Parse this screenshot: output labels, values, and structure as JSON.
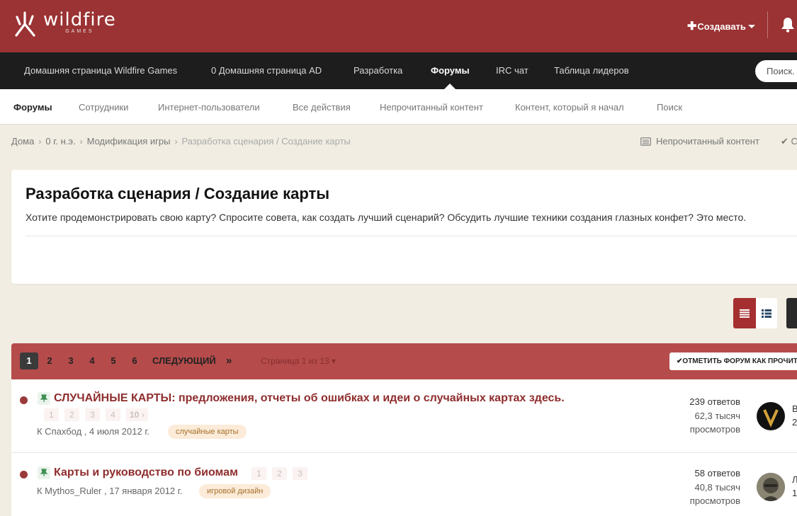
{
  "header": {
    "logo_word": "wildfire",
    "logo_sub": "GAMES",
    "create_label": "Создавать",
    "icons": [
      "wildfire-logo-icon",
      "plus-icon",
      "caret-down-icon",
      "bell-icon"
    ]
  },
  "nav": {
    "items": [
      {
        "label": "Домашняя страница Wildfire Games"
      },
      {
        "label": "0 Домашняя страница AD"
      },
      {
        "label": "Разработка"
      },
      {
        "label": "Форумы"
      },
      {
        "label": "IRC чат"
      },
      {
        "label": "Таблица лидеров"
      }
    ],
    "active_label": "Форумы",
    "search_placeholder": "Поиск."
  },
  "subnav": {
    "items": [
      {
        "label": "Форумы"
      },
      {
        "label": "Сотрудники"
      },
      {
        "label": "Интернет-пользователи"
      },
      {
        "label": "Все действия"
      },
      {
        "label": "Непрочитанный контент"
      },
      {
        "label": "Контент, который я начал"
      },
      {
        "label": "Поиск"
      }
    ],
    "active_label": "Форумы"
  },
  "breadcrumb": {
    "items": [
      "Дома",
      "0 г. н.э.",
      "Модификация игры",
      "Разработка сценария / Создание карты"
    ],
    "right_link": "Непрочитанный контент",
    "right_link2": "С"
  },
  "forum": {
    "title": "Разработка сценария / Создание карты",
    "description": "Хотите продемонстрировать свою карту? Спросите совета, как создать лучший сценарий? Обсудить лучшие техники создания глазных конфет? Это место."
  },
  "pagination": {
    "pages": [
      "1",
      "2",
      "3",
      "4",
      "5",
      "6"
    ],
    "current": "1",
    "next_label": "СЛЕДУЮЩИЙ",
    "last_label": "»",
    "page_info": "Страница 1 из 13",
    "mark_read_label": "ОТМЕТИТЬ ФОРУМ КАК ПРОЧИТАННЫЙ"
  },
  "topics": [
    {
      "title": "СЛУЧАЙНЫЕ КАРТЫ: предложения, отчеты об ошибках и идеи о случайных картах здесь.",
      "pages": [
        "1",
        "2",
        "3",
        "4",
        "10"
      ],
      "author_line": "К Спахбод , 4 июля 2012 г.",
      "tag": "случайные карты",
      "replies": "239 ответов",
      "views_line1": "62,3 тысяч",
      "views_line2": "просмотров",
      "last_poster": "В",
      "last_date": "2"
    },
    {
      "title": "Карты и руководство по биомам",
      "pages": [
        "1",
        "2",
        "3"
      ],
      "author_line": "К Mythos_Ruler , 17 января 2012 г.",
      "tag": "игровой дизайн",
      "replies": "58 ответов",
      "views_line1": "40,8 тысяч",
      "views_line2": "просмотров",
      "last_poster": "Л",
      "last_date": "1"
    }
  ],
  "colors": {
    "brand": "#9b3233",
    "nav_bg": "#1d1d1d",
    "pager_bg": "#b54b4b",
    "topic_title": "#8f2d2d"
  }
}
